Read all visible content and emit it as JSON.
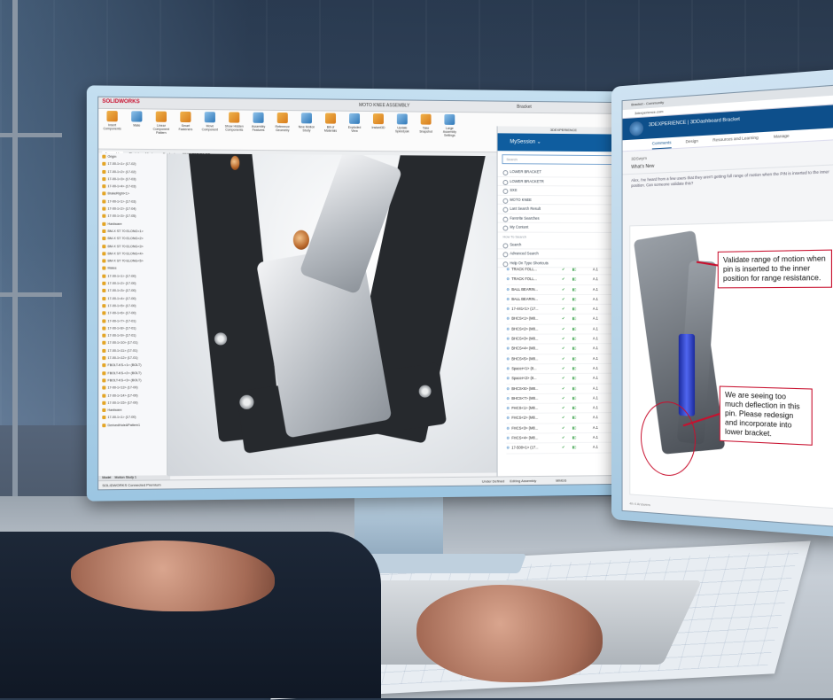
{
  "monitor1": {
    "app_logo": "SOLIDWORKS",
    "document_title": "MOTO KNEE ASSEMBLY",
    "user_badge": "Bracket",
    "ribbon": [
      {
        "label": "Insert Components"
      },
      {
        "label": "Mate"
      },
      {
        "label": "Linear Component Pattern"
      },
      {
        "label": "Smart Fasteners"
      },
      {
        "label": "Move Component"
      },
      {
        "label": "Show Hidden Components"
      },
      {
        "label": "Assembly Features"
      },
      {
        "label": "Reference Geometry"
      },
      {
        "label": "New Motion Study"
      },
      {
        "label": "Bill of Materials"
      },
      {
        "label": "Exploded View"
      },
      {
        "label": "Instant3D"
      },
      {
        "label": "Update Speedpak"
      },
      {
        "label": "Take Snapshot"
      },
      {
        "label": "Large Assembly Settings"
      }
    ],
    "tabs": [
      "Assembly",
      "Sketch",
      "Markup",
      "Evaluate",
      "3DEXPERIENCE"
    ],
    "tree_items": [
      "Origin",
      "17-00-1<1> (17-02)",
      "17-00-1<2> (17-02)",
      "17-00-1<3> (17-03)",
      "17-00-1<4> (17-03)",
      "BrakeRight<1>",
      "17-00-1<1> (17-03)",
      "17-00-1<2> (17-04)",
      "17-00-1<3> (17-05)",
      "Hardware",
      "BM-X ST 70 ELONG<1>",
      "BM-X ST 70 ELONG<2>",
      "BM-X ST 70 ELONG<3>",
      "BM-X ST 70 ELONG<4>",
      "BM-X ST 70 ELONG<5>",
      "Mates",
      "17-00-1<1> (17-00)",
      "17-00-1<2> (17-00)",
      "17-00-1<3> (17-00)",
      "17-00-1<4> (17-00)",
      "17-00-1<5> (17-00)",
      "17-00-1<6> (17-00)",
      "17-00-1<7> (17-01)",
      "17-00-1<8> (17-01)",
      "17-00-1<9> (17-01)",
      "17-00-1<10> (17-01)",
      "17-00-1<11> (17-01)",
      "17-00-1<12> (17-01)",
      "FBOLT-KS-<1> (BOLT)",
      "FBOLT-KS-<2> (BOLT)",
      "FBOLT-KS-<3> (BOLT)",
      "17-00-1<13> (17-00)",
      "17-00-1<14> (17-00)",
      "17-00-1<15> (17-00)",
      "Hardware",
      "17-00-1<1> (17-00)",
      "DerivedHoleAPattern1"
    ],
    "bottom_tabs": [
      "Model",
      "Motion Study 1"
    ],
    "status": {
      "left": "SOLIDWORKS Connected Premium",
      "under_defined": "Under Defined",
      "editing": "Editing Assembly",
      "units": "MMGS"
    },
    "panel": {
      "header": "3DEXPERIENCE",
      "session": "MySession",
      "search_placeholder": "Search",
      "menu_items": [
        "LOWER BRACKET",
        "LOWER BRACKETR",
        "SXE",
        "MOTO KNEE",
        "Last Search Result",
        "Favorite Searches",
        "My Content"
      ],
      "how_to_search": "How To Search",
      "search_items": [
        "Search",
        "Advanced Search",
        "Help On Type Shortcuts"
      ],
      "bom": [
        {
          "name": "TRACK FOLL...",
          "rev": "A.1"
        },
        {
          "name": "TRACK FOLL...",
          "rev": "A.1"
        },
        {
          "name": "BALL BEARIN...",
          "rev": "A.1"
        },
        {
          "name": "BALL BEARIN...",
          "rev": "A.1"
        },
        {
          "name": "17-441<1> (17...",
          "rev": "A.1"
        },
        {
          "name": "BHCS<1> (M8...",
          "rev": "A.1"
        },
        {
          "name": "BHCS<2> (M8...",
          "rev": "A.1"
        },
        {
          "name": "BHCS<3> (M8...",
          "rev": "A.1"
        },
        {
          "name": "BHCS<4> (M8...",
          "rev": "A.1"
        },
        {
          "name": "BHCS<5> (M8...",
          "rev": "A.1"
        },
        {
          "name": "Spacer<1> (8...",
          "rev": "A.1"
        },
        {
          "name": "Spacer<2> (8...",
          "rev": "A.1"
        },
        {
          "name": "BHCS<6> (M8...",
          "rev": "A.1"
        },
        {
          "name": "BHCS<7> (M8...",
          "rev": "A.1"
        },
        {
          "name": "FHCS<1> (M8...",
          "rev": "A.1"
        },
        {
          "name": "FHCS<2> (M8...",
          "rev": "A.1"
        },
        {
          "name": "FHCS<3> (M8...",
          "rev": "A.1"
        },
        {
          "name": "FHCS<4> (M8...",
          "rev": "A.1"
        },
        {
          "name": "17-500<1> (17...",
          "rev": "A.1"
        }
      ]
    }
  },
  "monitor2": {
    "tab_title": "Bracket - Community",
    "url": "3dexperience.com",
    "brand": "3DEXPERIENCE | 3DDashboard  Bracket",
    "nav": [
      "Comments",
      "Design",
      "Resources and Learning",
      "Manage"
    ],
    "crumb": "3DSwym",
    "title": "What's New",
    "comment": "Alex, I've heard from a few users that they aren't getting full range of motion when the PIN is inserted to the inner position. Can someone validate this?",
    "callout_top": "Validate range of motion when pin is inserted to the inner position for range resistance.",
    "callout_bottom": "We are seeing too much deflection in this pin. Please redesign and incorporate into lower bracket.",
    "footer": "4h    4 Answers"
  },
  "colors": {
    "accent_blue": "#0f5d9f",
    "callout_red": "#c8102e",
    "bronze": "#b8672a"
  }
}
